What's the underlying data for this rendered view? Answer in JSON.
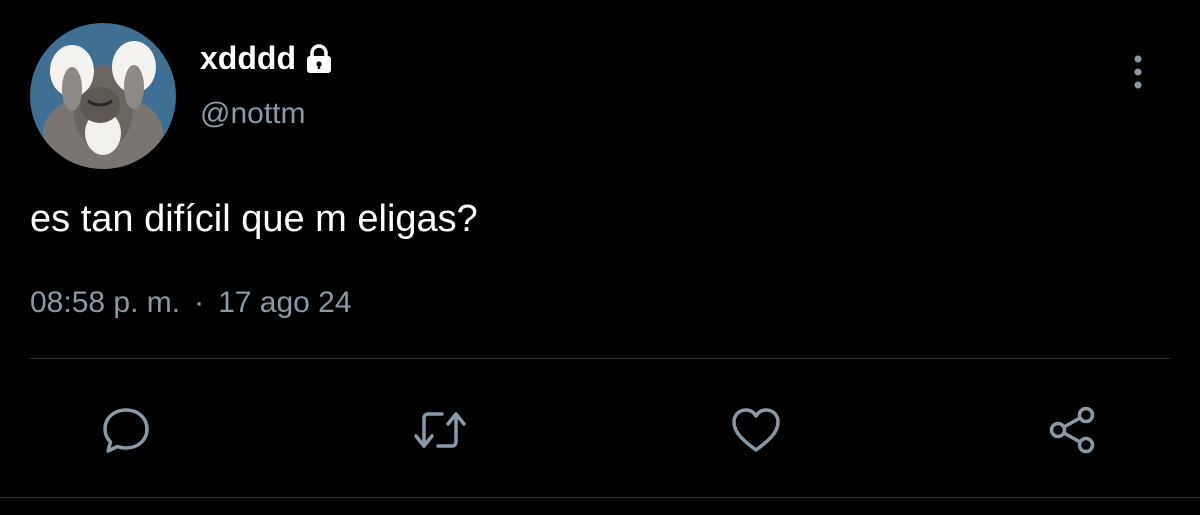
{
  "tweet": {
    "display_name": "xdddd",
    "handle": "@nottm",
    "text": "es tan difícil que m eligas?",
    "time": "08:58 p. m.",
    "separator": "·",
    "date": "17 ago 24"
  },
  "icons": {
    "lock": "lock-icon",
    "more": "more-vertical-icon",
    "reply": "reply-icon",
    "retweet": "retweet-icon",
    "like": "heart-icon",
    "share": "share-icon"
  },
  "colors": {
    "background": "#000000",
    "primary_text": "#ffffff",
    "secondary_text": "#8b98a5",
    "divider": "#2f3336"
  }
}
